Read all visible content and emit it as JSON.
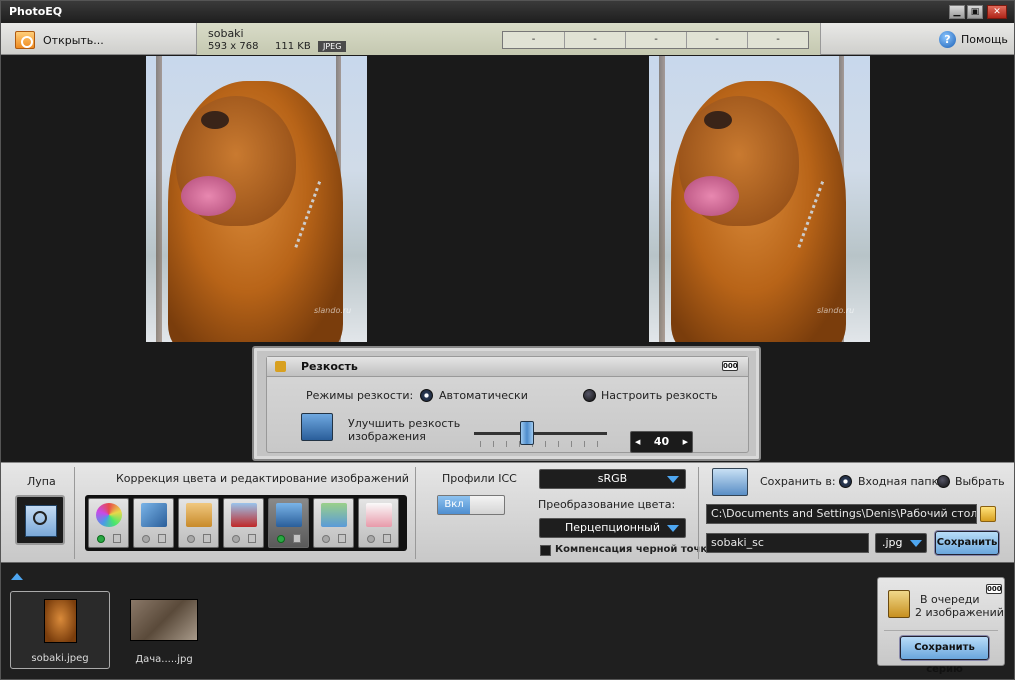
{
  "window": {
    "title": "PhotoEQ",
    "min": "▁",
    "max": "▣",
    "close": "✕"
  },
  "toolbar": {
    "open_label": "Открыть...",
    "file_name": "sobaki",
    "file_dims": "593 x 768",
    "file_size": "111 KB",
    "file_format": "JPEG",
    "slots": [
      "-",
      "-",
      "-",
      "-",
      "-"
    ],
    "help_label": "Помощь"
  },
  "images": {
    "watermark": "slando.ru"
  },
  "sharpness": {
    "title": "Резкость",
    "badge": "000",
    "modes_label": "Режимы резкости:",
    "mode_auto": "Автоматически",
    "mode_manual": "Настроить резкость",
    "selected_mode": "auto",
    "enhance_label_1": "Улучшить резкость",
    "enhance_label_2": "изображения",
    "value": "40",
    "slider_fraction": 0.4,
    "spin_left": "◀",
    "spin_right": "▶"
  },
  "controls": {
    "loupe_title": "Лупа",
    "tools_title": "Коррекция цвета и редактирование изображений",
    "tools": [
      {
        "name": "color-wheel-icon",
        "color": "#e84a9a",
        "active": false,
        "on": true
      },
      {
        "name": "rotate-icon",
        "color": "#3f7fc4",
        "active": false,
        "on": false
      },
      {
        "name": "crop-icon",
        "color": "#d89a3a",
        "active": false,
        "on": false
      },
      {
        "name": "scissors-icon",
        "color": "#c02828",
        "active": false,
        "on": false
      },
      {
        "name": "sharpen-icon",
        "color": "#4a7ab4",
        "active": true,
        "on": true
      },
      {
        "name": "eraser-icon",
        "color": "#6aa0d4",
        "active": false,
        "on": false
      },
      {
        "name": "brush-icon",
        "color": "#d86a8a",
        "active": false,
        "on": false
      }
    ],
    "icc_title": "Профили ICC",
    "icc_toggle": "Вкл",
    "profile_value": "sRGB",
    "conversion_label": "Преобразование цвета:",
    "conversion_value": "Перцепционный",
    "bpc_label": "Компенсация черной точки",
    "save_in_label": "Сохранить в:",
    "save_input_folder": "Входная папка",
    "save_choose": "Выбрать",
    "save_path": "C:\\Documents and Settings\\Denis\\Рабочий стол\\",
    "save_filename": "sobaki_sc",
    "save_ext": ".jpg",
    "save_button": "Сохранить"
  },
  "queue": {
    "thumbs": [
      {
        "name": "sobaki.jpeg",
        "selected": true
      },
      {
        "name": "Дача.....jpg",
        "selected": false
      }
    ],
    "badge": "000",
    "status_line_1": "В очереди",
    "status_line_2": "2 изображений",
    "save_batch_button": "Сохранить серию"
  },
  "colors": {
    "accent": "#4ea6f0",
    "button_blue": "#6aa6dc",
    "active_green": "#2aa844"
  }
}
